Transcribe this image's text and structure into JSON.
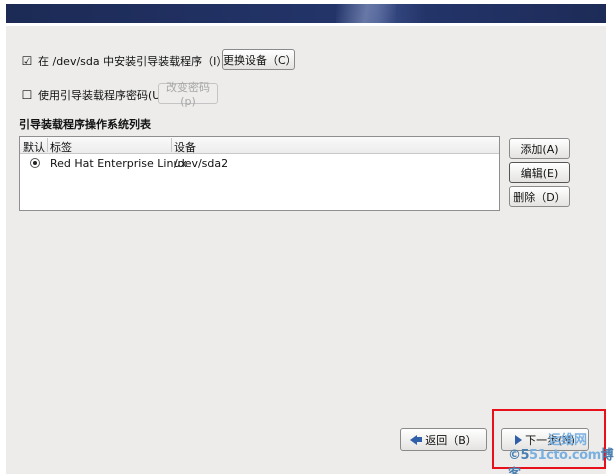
{
  "install_bootloader": {
    "checked": "☑",
    "label": "在 /dev/sda 中安装引导装载程序（I）。",
    "change_device_button": "更换设备（C）"
  },
  "bootloader_password": {
    "checked": "☐",
    "label": "使用引导装载程序密码(U)",
    "change_password_button": "改变密码(p)"
  },
  "os_list": {
    "title": "引导装载程序操作系统列表",
    "columns": [
      "默认",
      "标签",
      "设备"
    ],
    "rows": [
      {
        "default": true,
        "label": "Red Hat Enterprise Linux",
        "device": "/dev/sda2"
      }
    ],
    "buttons": {
      "add": "添加(A)",
      "edit": "编辑(E)",
      "delete": "删除（D）"
    }
  },
  "navigation": {
    "back": "返回（B）",
    "next": "下一步(N)"
  },
  "watermark": {
    "site": "51cto.com",
    "prefix": "©5",
    "suffix": "博客",
    "brand": "运维网"
  },
  "colors": {
    "highlight_box": "#e8101a",
    "header_bar": "#233469"
  }
}
